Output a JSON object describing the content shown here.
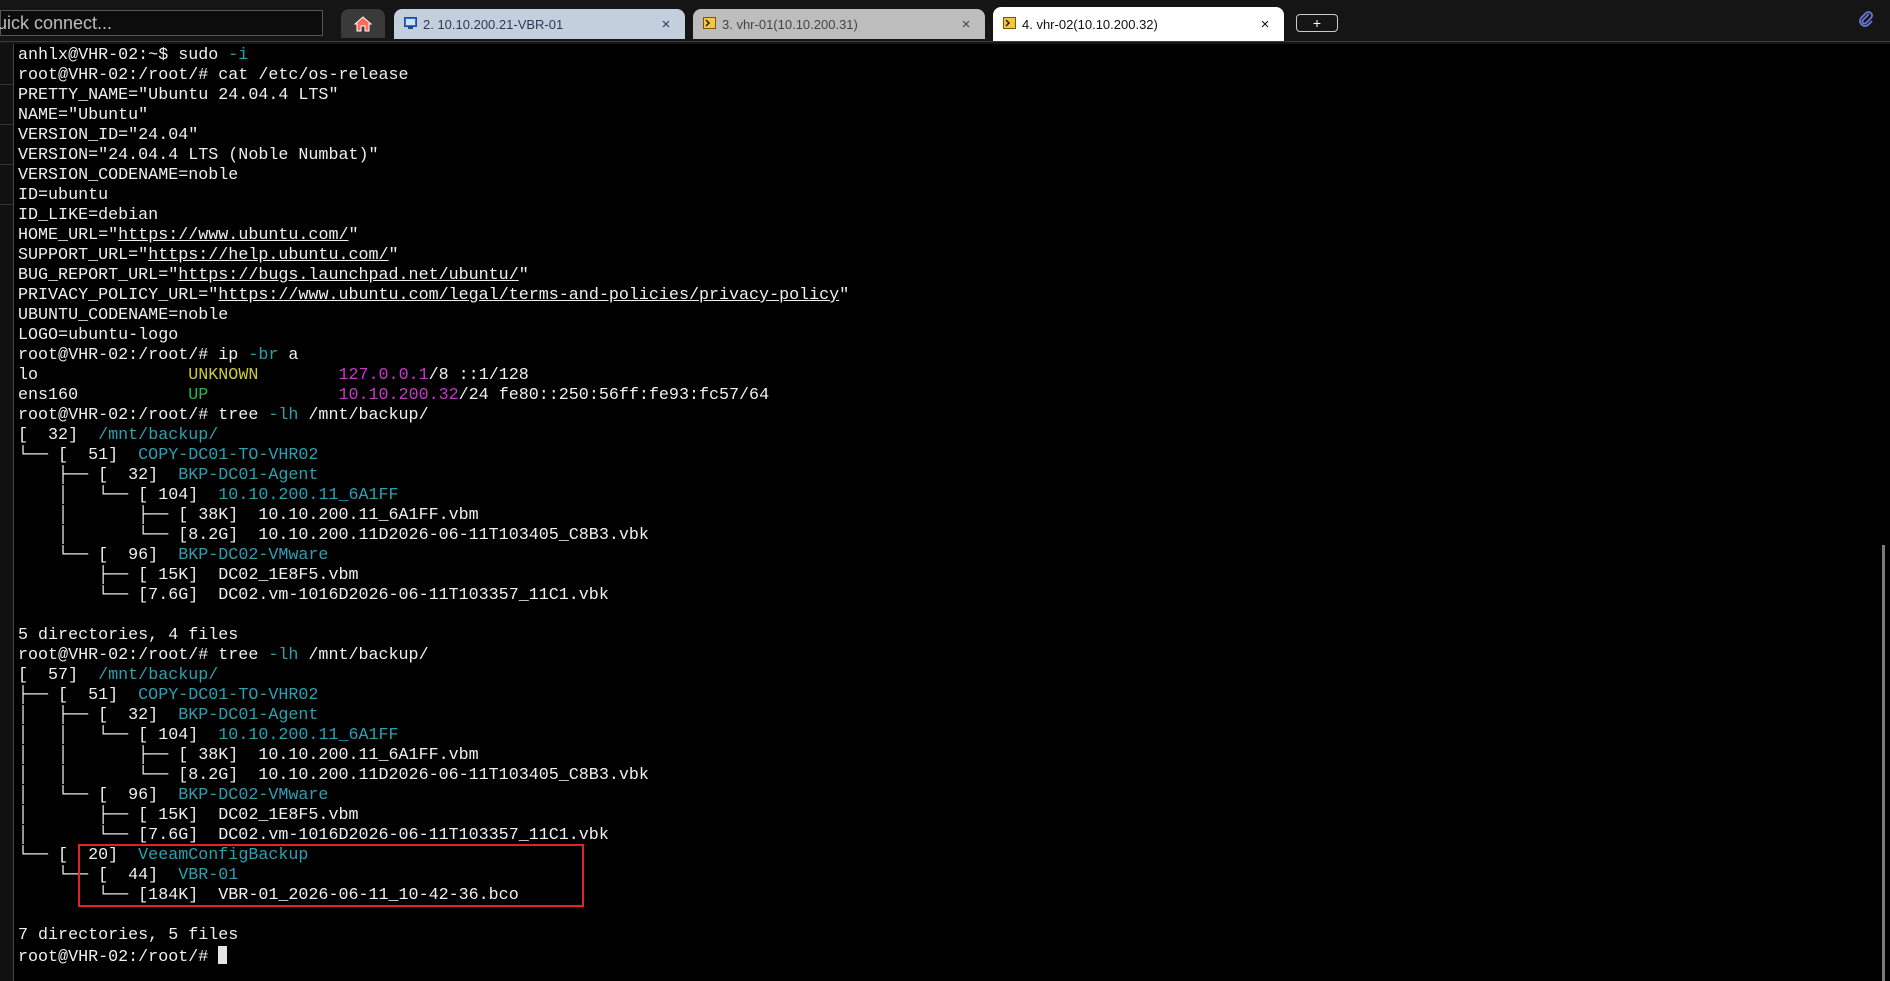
{
  "window": {
    "quick_connect_placeholder": "uick connect..."
  },
  "tabs": [
    {
      "icon": "remote-desktop-icon",
      "label": "2. 10.10.200.21-VBR-01",
      "close": "×"
    },
    {
      "icon": "ssh-terminal-icon",
      "label": "3. vhr-01(10.10.200.31)",
      "close": "×"
    },
    {
      "icon": "ssh-terminal-icon",
      "label": "4. vhr-02(10.10.200.32)",
      "close": "×",
      "active": true
    }
  ],
  "new_tab_label": "+",
  "colors": {
    "directory": "#2aa1b3",
    "address": "#c639c6",
    "state_unknown": "#cdcb3a",
    "state_up": "#2bb84e",
    "highlight_box": "#e02424"
  },
  "terminal": {
    "lines": [
      {
        "parts": [
          {
            "t": "anhlx@VHR-02:~$ sudo "
          },
          {
            "t": "-i",
            "c": "cy"
          }
        ]
      },
      {
        "parts": [
          {
            "t": "root@VHR-02:/root/# cat /etc/os-release"
          }
        ]
      },
      {
        "parts": [
          {
            "t": "PRETTY_NAME=\"Ubuntu 24.04.4 LTS\""
          }
        ]
      },
      {
        "parts": [
          {
            "t": "NAME=\"Ubuntu\""
          }
        ]
      },
      {
        "parts": [
          {
            "t": "VERSION_ID=\"24.04\""
          }
        ]
      },
      {
        "parts": [
          {
            "t": "VERSION=\"24.04.4 LTS (Noble Numbat)\""
          }
        ]
      },
      {
        "parts": [
          {
            "t": "VERSION_CODENAME=noble"
          }
        ]
      },
      {
        "parts": [
          {
            "t": "ID=ubuntu"
          }
        ]
      },
      {
        "parts": [
          {
            "t": "ID_LIKE=debian"
          }
        ]
      },
      {
        "parts": [
          {
            "t": "HOME_URL=\""
          },
          {
            "t": "https://www.ubuntu.com/",
            "c": "u"
          },
          {
            "t": "\""
          }
        ]
      },
      {
        "parts": [
          {
            "t": "SUPPORT_URL=\""
          },
          {
            "t": "https://help.ubuntu.com/",
            "c": "u"
          },
          {
            "t": "\""
          }
        ]
      },
      {
        "parts": [
          {
            "t": "BUG_REPORT_URL=\""
          },
          {
            "t": "https://bugs.launchpad.net/ubuntu/",
            "c": "u"
          },
          {
            "t": "\""
          }
        ]
      },
      {
        "parts": [
          {
            "t": "PRIVACY_POLICY_URL=\""
          },
          {
            "t": "https://www.ubuntu.com/legal/terms-and-policies/privacy-policy",
            "c": "u"
          },
          {
            "t": "\""
          }
        ]
      },
      {
        "parts": [
          {
            "t": "UBUNTU_CODENAME=noble"
          }
        ]
      },
      {
        "parts": [
          {
            "t": "LOGO=ubuntu-logo"
          }
        ]
      },
      {
        "parts": [
          {
            "t": "root@VHR-02:/root/# ip "
          },
          {
            "t": "-br",
            "c": "cy"
          },
          {
            "t": " a"
          }
        ]
      },
      {
        "parts": [
          {
            "t": "lo               "
          },
          {
            "t": "UNKNOWN",
            "c": "yl"
          },
          {
            "t": "        "
          },
          {
            "t": "127.0.0.1",
            "c": "mg"
          },
          {
            "t": "/8 ::1/128"
          }
        ]
      },
      {
        "parts": [
          {
            "t": "ens160           "
          },
          {
            "t": "UP",
            "c": "gn"
          },
          {
            "t": "             "
          },
          {
            "t": "10.10.200.32",
            "c": "mg"
          },
          {
            "t": "/24 fe80::250:56ff:fe93:fc57/64"
          }
        ]
      },
      {
        "parts": [
          {
            "t": "root@VHR-02:/root/# tree "
          },
          {
            "t": "-lh",
            "c": "cy"
          },
          {
            "t": " /mnt/backup/"
          }
        ]
      },
      {
        "parts": [
          {
            "t": "[  32]  "
          },
          {
            "t": "/mnt/backup/",
            "c": "cy"
          }
        ]
      },
      {
        "parts": [
          {
            "t": "└── [  51]  "
          },
          {
            "t": "COPY-DC01-TO-VHR02",
            "c": "cy"
          }
        ]
      },
      {
        "parts": [
          {
            "t": "    ├── [  32]  "
          },
          {
            "t": "BKP-DC01-Agent",
            "c": "cy"
          }
        ]
      },
      {
        "parts": [
          {
            "t": "    │   └── [ 104]  "
          },
          {
            "t": "10.10.200.11_6A1FF",
            "c": "cy"
          }
        ]
      },
      {
        "parts": [
          {
            "t": "    │       ├── [ 38K]  10.10.200.11_6A1FF.vbm"
          }
        ]
      },
      {
        "parts": [
          {
            "t": "    │       └── [8.2G]  10.10.200.11D2026-06-11T103405_C8B3.vbk"
          }
        ]
      },
      {
        "parts": [
          {
            "t": "    └── [  96]  "
          },
          {
            "t": "BKP-DC02-VMware",
            "c": "cy"
          }
        ]
      },
      {
        "parts": [
          {
            "t": "        ├── [ 15K]  DC02_1E8F5.vbm"
          }
        ]
      },
      {
        "parts": [
          {
            "t": "        └── [7.6G]  DC02.vm-1016D2026-06-11T103357_11C1.vbk"
          }
        ]
      },
      {
        "parts": [
          {
            "t": ""
          }
        ]
      },
      {
        "parts": [
          {
            "t": "5 directories, 4 files"
          }
        ]
      },
      {
        "parts": [
          {
            "t": "root@VHR-02:/root/# tree "
          },
          {
            "t": "-lh",
            "c": "cy"
          },
          {
            "t": " /mnt/backup/"
          }
        ]
      },
      {
        "parts": [
          {
            "t": "[  57]  "
          },
          {
            "t": "/mnt/backup/",
            "c": "cy"
          }
        ]
      },
      {
        "parts": [
          {
            "t": "├── [  51]  "
          },
          {
            "t": "COPY-DC01-TO-VHR02",
            "c": "cy"
          }
        ]
      },
      {
        "parts": [
          {
            "t": "│   ├── [  32]  "
          },
          {
            "t": "BKP-DC01-Agent",
            "c": "cy"
          }
        ]
      },
      {
        "parts": [
          {
            "t": "│   │   └── [ 104]  "
          },
          {
            "t": "10.10.200.11_6A1FF",
            "c": "cy"
          }
        ]
      },
      {
        "parts": [
          {
            "t": "│   │       ├── [ 38K]  10.10.200.11_6A1FF.vbm"
          }
        ]
      },
      {
        "parts": [
          {
            "t": "│   │       └── [8.2G]  10.10.200.11D2026-06-11T103405_C8B3.vbk"
          }
        ]
      },
      {
        "parts": [
          {
            "t": "│   └── [  96]  "
          },
          {
            "t": "BKP-DC02-VMware",
            "c": "cy"
          }
        ]
      },
      {
        "parts": [
          {
            "t": "│       ├── [ 15K]  DC02_1E8F5.vbm"
          }
        ]
      },
      {
        "parts": [
          {
            "t": "│       └── [7.6G]  DC02.vm-1016D2026-06-11T103357_11C1.vbk"
          }
        ]
      },
      {
        "parts": [
          {
            "t": "└── [  20]  "
          },
          {
            "t": "VeeamConfigBackup",
            "c": "cy"
          }
        ]
      },
      {
        "parts": [
          {
            "t": "    └── [  44]  "
          },
          {
            "t": "VBR-01",
            "c": "cy"
          }
        ]
      },
      {
        "parts": [
          {
            "t": "        └── [184K]  VBR-01_2026-06-11_10-42-36.bco"
          }
        ]
      },
      {
        "parts": [
          {
            "t": ""
          }
        ]
      },
      {
        "parts": [
          {
            "t": "7 directories, 5 files"
          }
        ]
      },
      {
        "parts": [
          {
            "t": "root@VHR-02:/root/# "
          }
        ],
        "cursor": true
      }
    ]
  }
}
